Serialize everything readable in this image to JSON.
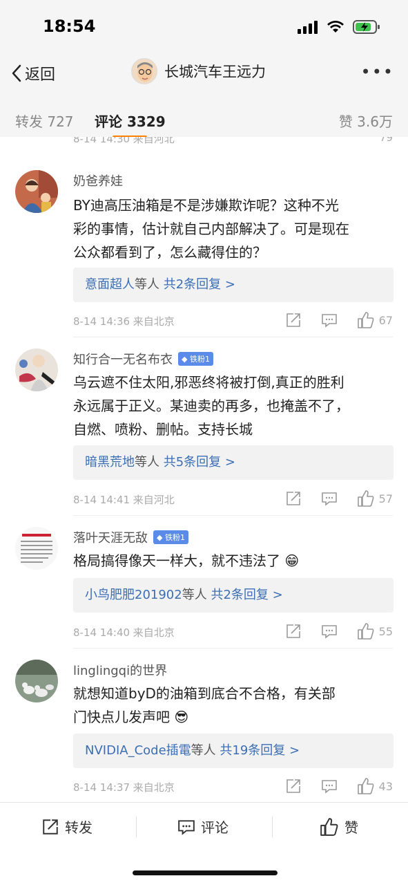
{
  "status": {
    "time": "18:54"
  },
  "nav": {
    "back_label": "返回",
    "title": "长城汽车王远力"
  },
  "tabs": {
    "repost": "转发 727",
    "comment": "评论 3329",
    "like": "赞 3.6万"
  },
  "partial": {
    "text": "8-14 14:30 来自河北",
    "likes": "79"
  },
  "comments": [
    {
      "username": "奶爸养娃",
      "badge": "",
      "text_lines": [
        "BY迪高压油箱是不是涉嫌欺诈呢？这种不光",
        "彩的事情，估计就自己内部解决了。可是现在",
        "公众都看到了，怎么藏得住的？"
      ],
      "reply_name": "意面超人",
      "reply_mid": "等人",
      "reply_more": "共2条回复 >",
      "meta": "8-14 14:36 来自北京",
      "likes": "67"
    },
    {
      "username": "知行合一无名布衣",
      "badge": "铁粉1",
      "text_lines": [
        "乌云遮不住太阳,邪恶终将被打倒,真正的胜利",
        "永远属于正义。某迪卖的再多，也掩盖不了，",
        "自燃、喷粉、删帖。支持长城"
      ],
      "reply_name": "暗黑荒地",
      "reply_mid": "等人",
      "reply_more": "共5条回复 >",
      "meta": "8-14 14:41 来自河北",
      "likes": "57"
    },
    {
      "username": "落叶天涯无敌",
      "badge": "铁粉1",
      "text_lines": [
        "格局搞得像天一样大，就不违法了 😁"
      ],
      "reply_name": "小鸟肥肥201902",
      "reply_mid": "等人",
      "reply_more": "共2条回复 >",
      "meta": "8-14 14:40 来自北京",
      "likes": "55"
    },
    {
      "username": "linglingqi的世界",
      "badge": "",
      "text_lines": [
        "就想知道byD的油箱到底合不合格，有关部",
        "门快点儿发声吧 😎"
      ],
      "reply_name": "NVIDIA_Code插電",
      "reply_mid": "等人",
      "reply_more": "共19条回复 >",
      "meta": "8-14 14:37 来自北京",
      "likes": "43"
    }
  ],
  "bottom": {
    "repost": "转发",
    "comment": "评论",
    "like": "赞"
  },
  "colors": {
    "accent": "#ff8200",
    "link": "#3b6eb5",
    "badge": "#5a8be8"
  }
}
